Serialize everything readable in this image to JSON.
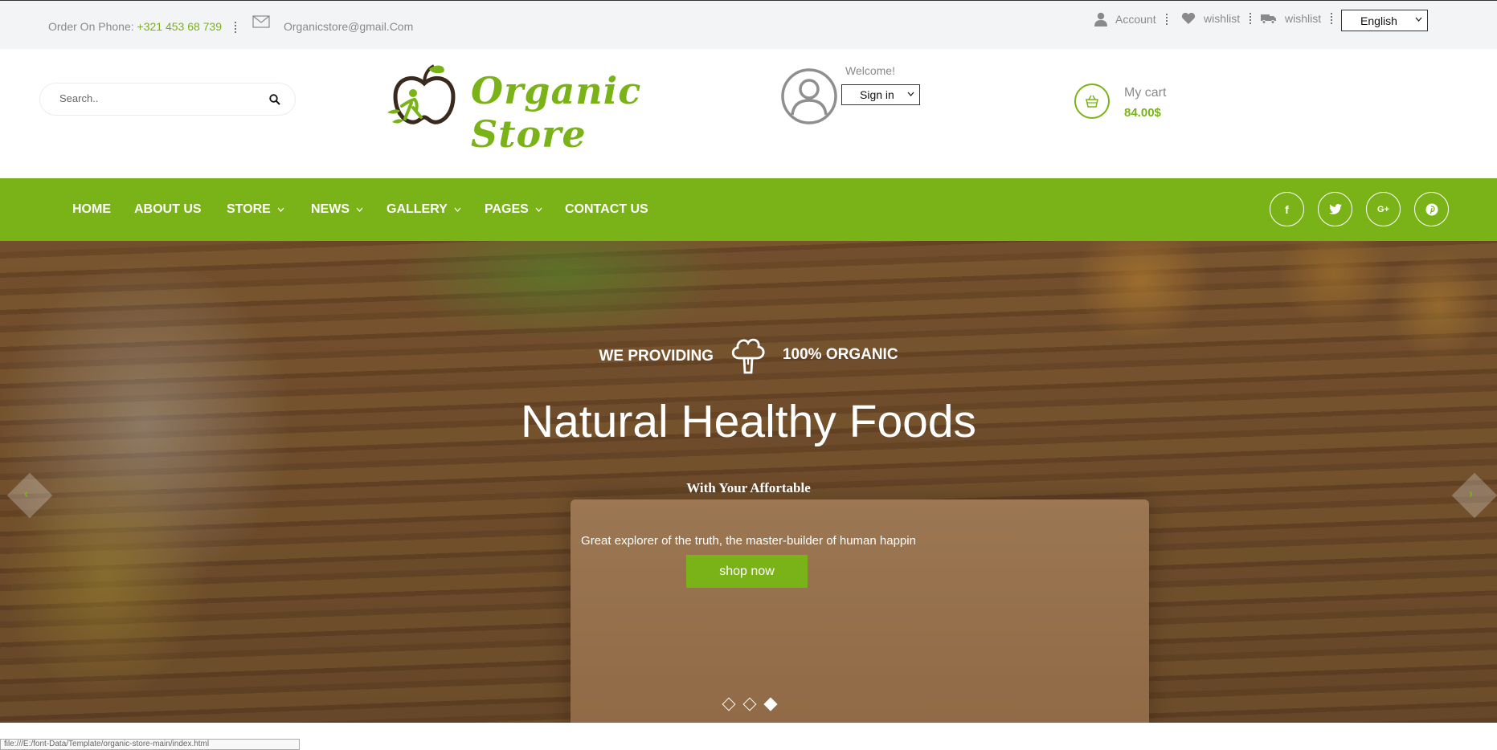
{
  "topbar": {
    "phone_label": "Order On Phone:",
    "phone_number": "+321 453 68 739",
    "email": "Organicstore@gmail.Com",
    "links": [
      {
        "icon": "user-icon",
        "label": "Account"
      },
      {
        "icon": "heart-icon",
        "label": "wishlist"
      },
      {
        "icon": "truck-icon",
        "label": "wishlist"
      }
    ],
    "language": "English"
  },
  "header": {
    "search_placeholder": "Search..",
    "logo_text": "Organic Store",
    "welcome": "Welcome!",
    "signin": "Sign in",
    "cart_label": "My cart",
    "cart_total": "84.00$"
  },
  "nav": {
    "items": [
      {
        "label": "HOME",
        "has_dropdown": false
      },
      {
        "label": "ABOUT US",
        "has_dropdown": false
      },
      {
        "label": "STORE",
        "has_dropdown": true
      },
      {
        "label": "NEWS",
        "has_dropdown": true
      },
      {
        "label": "GALLERY",
        "has_dropdown": true
      },
      {
        "label": "PAGES",
        "has_dropdown": true
      },
      {
        "label": "CONTACT US",
        "has_dropdown": false
      }
    ],
    "social": [
      {
        "icon": "facebook-icon",
        "glyph": "f"
      },
      {
        "icon": "twitter-icon",
        "glyph": "t"
      },
      {
        "icon": "google-plus-icon",
        "glyph": "G+"
      },
      {
        "icon": "pinterest-icon",
        "glyph": "P"
      }
    ]
  },
  "hero": {
    "kicker_left": "WE PROVIDING",
    "kicker_right": "100% ORGANIC",
    "title": "Natural Healthy Foods",
    "subtitle": "With Your Affortable",
    "description": "Great explorer of the truth, the master-builder of human happin",
    "button": "shop now",
    "slides": 3,
    "active_slide": 3
  },
  "colors": {
    "accent": "#7ab317",
    "topbar_bg": "#f3f4f6",
    "text_muted": "#8a8a8a"
  },
  "status_bar": "file:///E:/font-Data/Template/organic-store-main/index.html"
}
